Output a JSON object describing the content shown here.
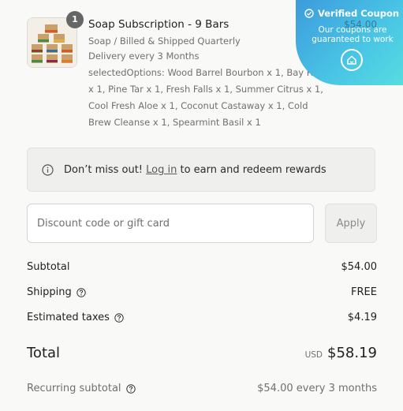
{
  "product": {
    "quantity": "1",
    "title": "Soap Subscription - 9 Bars",
    "variant": "Soap / Billed & Shipped Quarterly",
    "delivery": "Delivery every 3 Months",
    "options": "selectedOptions: Wood Barrel Bourbon x 1, Bay Rum x 1, Pine Tar x 1, Fresh Falls x 1, Summer Citrus x 1, Cool Fresh Aloe x 1, Coconut Castaway x 1, Cold Brew Cleanse x 1, Spearmint Basil x 1"
  },
  "rewards": {
    "prefix": "Don’t miss out! ",
    "link": "Log in",
    "suffix": " to earn and redeem rewards"
  },
  "discount": {
    "placeholder": "Discount code or gift card",
    "apply_label": "Apply"
  },
  "summary": {
    "subtotal_label": "Subtotal",
    "subtotal_value": "$54.00",
    "shipping_label": "Shipping",
    "shipping_value": "FREE",
    "taxes_label": "Estimated taxes",
    "taxes_value": "$4.19",
    "total_label": "Total",
    "currency": "USD",
    "total_value": "$58.19",
    "recurring_label": "Recurring subtotal",
    "recurring_value": "$54.00 every 3 months"
  },
  "coupon": {
    "title": "Verified Coupon",
    "ghost_price": "$54.00",
    "subtitle_line1": "Our coupons are",
    "subtitle_line2": "guaranteed to work"
  },
  "colors": {
    "coupon_gradient_start": "#3d9bdc",
    "coupon_gradient_end": "#57dce0",
    "background": "#f9f9f8"
  },
  "icons": [
    "info-icon",
    "help-circle-icon",
    "check-circle-icon",
    "coupon-logo-icon"
  ]
}
